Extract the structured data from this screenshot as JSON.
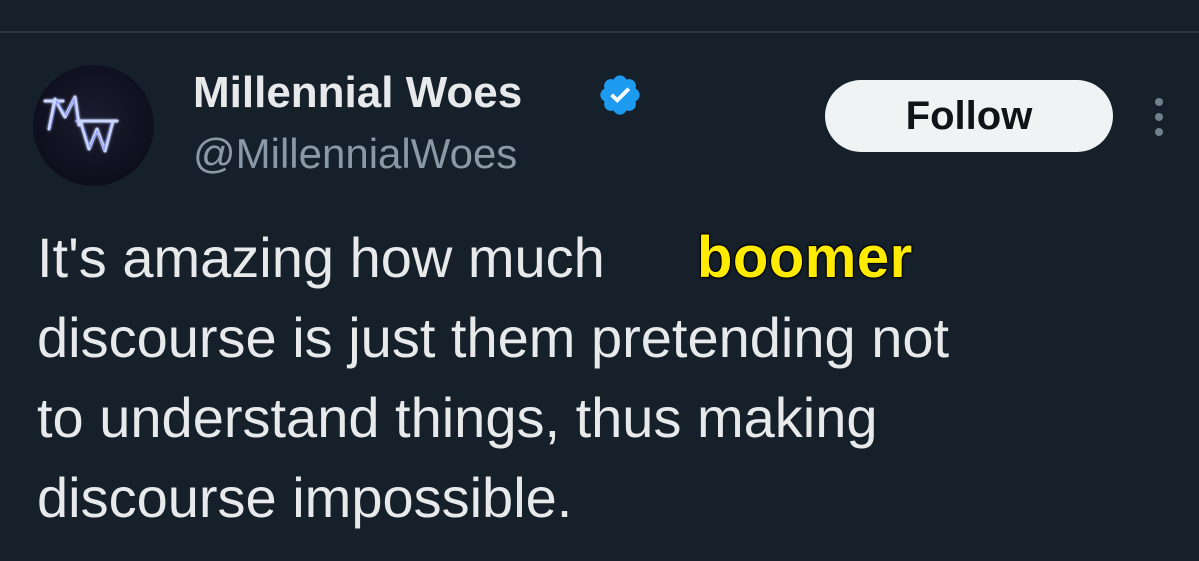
{
  "tweet": {
    "author": {
      "display_name": "Millennial Woes",
      "handle": "@MillennialWoes",
      "avatar_text": "MW",
      "verified": true,
      "verified_icon": "verified-badge-icon",
      "verified_color": "#1d9bf0"
    },
    "follow_label": "Follow",
    "more_icon": "more-options-icon",
    "text_lines": [
      "It's amazing how much",
      "discourse is just them pretending not",
      "to understand things, thus making",
      "discourse impossible."
    ],
    "overlay_word": "boomer",
    "overlay_color": "#ffeb00"
  },
  "colors": {
    "background": "#15202b",
    "text": "#e7e9ea",
    "secondary_text": "#8b98a5",
    "follow_bg": "#eff3f4"
  }
}
